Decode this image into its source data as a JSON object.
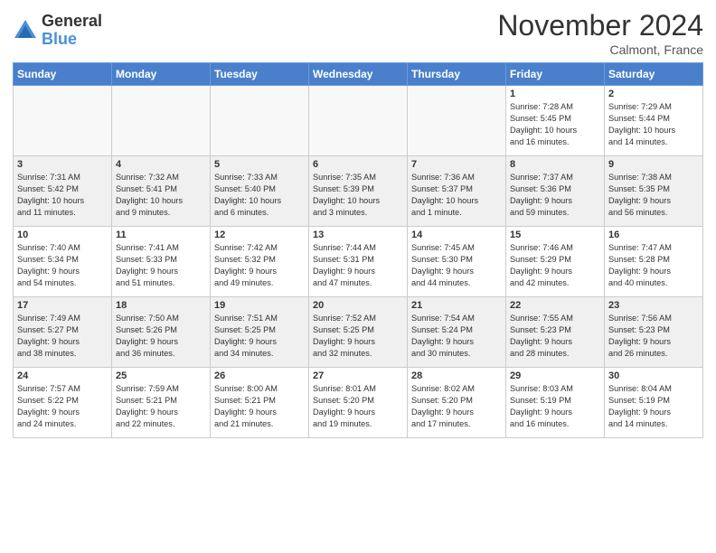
{
  "logo": {
    "general": "General",
    "blue": "Blue"
  },
  "title": "November 2024",
  "location": "Calmont, France",
  "weekdays": [
    "Sunday",
    "Monday",
    "Tuesday",
    "Wednesday",
    "Thursday",
    "Friday",
    "Saturday"
  ],
  "weeks": [
    [
      {
        "day": "",
        "info": ""
      },
      {
        "day": "",
        "info": ""
      },
      {
        "day": "",
        "info": ""
      },
      {
        "day": "",
        "info": ""
      },
      {
        "day": "",
        "info": ""
      },
      {
        "day": "1",
        "info": "Sunrise: 7:28 AM\nSunset: 5:45 PM\nDaylight: 10 hours\nand 16 minutes."
      },
      {
        "day": "2",
        "info": "Sunrise: 7:29 AM\nSunset: 5:44 PM\nDaylight: 10 hours\nand 14 minutes."
      }
    ],
    [
      {
        "day": "3",
        "info": "Sunrise: 7:31 AM\nSunset: 5:42 PM\nDaylight: 10 hours\nand 11 minutes."
      },
      {
        "day": "4",
        "info": "Sunrise: 7:32 AM\nSunset: 5:41 PM\nDaylight: 10 hours\nand 9 minutes."
      },
      {
        "day": "5",
        "info": "Sunrise: 7:33 AM\nSunset: 5:40 PM\nDaylight: 10 hours\nand 6 minutes."
      },
      {
        "day": "6",
        "info": "Sunrise: 7:35 AM\nSunset: 5:39 PM\nDaylight: 10 hours\nand 3 minutes."
      },
      {
        "day": "7",
        "info": "Sunrise: 7:36 AM\nSunset: 5:37 PM\nDaylight: 10 hours\nand 1 minute."
      },
      {
        "day": "8",
        "info": "Sunrise: 7:37 AM\nSunset: 5:36 PM\nDaylight: 9 hours\nand 59 minutes."
      },
      {
        "day": "9",
        "info": "Sunrise: 7:38 AM\nSunset: 5:35 PM\nDaylight: 9 hours\nand 56 minutes."
      }
    ],
    [
      {
        "day": "10",
        "info": "Sunrise: 7:40 AM\nSunset: 5:34 PM\nDaylight: 9 hours\nand 54 minutes."
      },
      {
        "day": "11",
        "info": "Sunrise: 7:41 AM\nSunset: 5:33 PM\nDaylight: 9 hours\nand 51 minutes."
      },
      {
        "day": "12",
        "info": "Sunrise: 7:42 AM\nSunset: 5:32 PM\nDaylight: 9 hours\nand 49 minutes."
      },
      {
        "day": "13",
        "info": "Sunrise: 7:44 AM\nSunset: 5:31 PM\nDaylight: 9 hours\nand 47 minutes."
      },
      {
        "day": "14",
        "info": "Sunrise: 7:45 AM\nSunset: 5:30 PM\nDaylight: 9 hours\nand 44 minutes."
      },
      {
        "day": "15",
        "info": "Sunrise: 7:46 AM\nSunset: 5:29 PM\nDaylight: 9 hours\nand 42 minutes."
      },
      {
        "day": "16",
        "info": "Sunrise: 7:47 AM\nSunset: 5:28 PM\nDaylight: 9 hours\nand 40 minutes."
      }
    ],
    [
      {
        "day": "17",
        "info": "Sunrise: 7:49 AM\nSunset: 5:27 PM\nDaylight: 9 hours\nand 38 minutes."
      },
      {
        "day": "18",
        "info": "Sunrise: 7:50 AM\nSunset: 5:26 PM\nDaylight: 9 hours\nand 36 minutes."
      },
      {
        "day": "19",
        "info": "Sunrise: 7:51 AM\nSunset: 5:25 PM\nDaylight: 9 hours\nand 34 minutes."
      },
      {
        "day": "20",
        "info": "Sunrise: 7:52 AM\nSunset: 5:25 PM\nDaylight: 9 hours\nand 32 minutes."
      },
      {
        "day": "21",
        "info": "Sunrise: 7:54 AM\nSunset: 5:24 PM\nDaylight: 9 hours\nand 30 minutes."
      },
      {
        "day": "22",
        "info": "Sunrise: 7:55 AM\nSunset: 5:23 PM\nDaylight: 9 hours\nand 28 minutes."
      },
      {
        "day": "23",
        "info": "Sunrise: 7:56 AM\nSunset: 5:23 PM\nDaylight: 9 hours\nand 26 minutes."
      }
    ],
    [
      {
        "day": "24",
        "info": "Sunrise: 7:57 AM\nSunset: 5:22 PM\nDaylight: 9 hours\nand 24 minutes."
      },
      {
        "day": "25",
        "info": "Sunrise: 7:59 AM\nSunset: 5:21 PM\nDaylight: 9 hours\nand 22 minutes."
      },
      {
        "day": "26",
        "info": "Sunrise: 8:00 AM\nSunset: 5:21 PM\nDaylight: 9 hours\nand 21 minutes."
      },
      {
        "day": "27",
        "info": "Sunrise: 8:01 AM\nSunset: 5:20 PM\nDaylight: 9 hours\nand 19 minutes."
      },
      {
        "day": "28",
        "info": "Sunrise: 8:02 AM\nSunset: 5:20 PM\nDaylight: 9 hours\nand 17 minutes."
      },
      {
        "day": "29",
        "info": "Sunrise: 8:03 AM\nSunset: 5:19 PM\nDaylight: 9 hours\nand 16 minutes."
      },
      {
        "day": "30",
        "info": "Sunrise: 8:04 AM\nSunset: 5:19 PM\nDaylight: 9 hours\nand 14 minutes."
      }
    ]
  ]
}
